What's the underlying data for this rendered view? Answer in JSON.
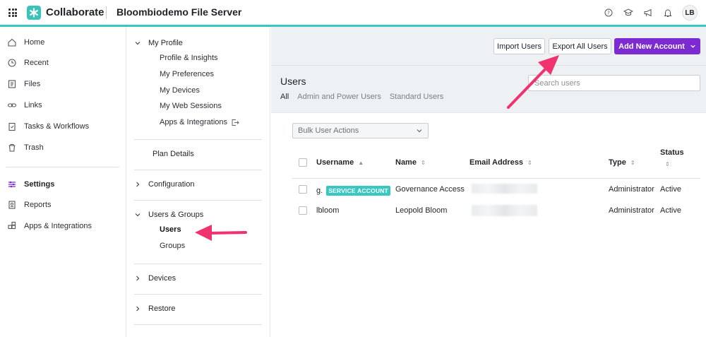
{
  "topbar": {
    "brand": "Collaborate",
    "server_name": "Bloombiodemo File Server",
    "icons": [
      "help-icon",
      "graduation-cap-icon",
      "megaphone-icon",
      "bell-icon"
    ],
    "avatar_initials": "LB"
  },
  "leftnav": {
    "items": [
      {
        "label": "Home",
        "icon": "home-icon"
      },
      {
        "label": "Recent",
        "icon": "clock-icon"
      },
      {
        "label": "Files",
        "icon": "files-icon"
      },
      {
        "label": "Links",
        "icon": "link-icon"
      },
      {
        "label": "Tasks & Workflows",
        "icon": "clipboard-icon"
      },
      {
        "label": "Trash",
        "icon": "trash-icon"
      }
    ],
    "bottom_items": [
      {
        "label": "Settings",
        "icon": "sliders-icon"
      },
      {
        "label": "Reports",
        "icon": "report-icon"
      },
      {
        "label": "Apps & Integrations",
        "icon": "apps-icon"
      }
    ]
  },
  "settings_nav": {
    "my_profile": {
      "label": "My Profile",
      "items": [
        "Profile & Insights",
        "My Preferences",
        "My Devices",
        "My Web Sessions",
        "Apps & Integrations"
      ]
    },
    "plan_details": "Plan Details",
    "configuration": "Configuration",
    "users_groups": {
      "label": "Users & Groups",
      "items": [
        "Users",
        "Groups"
      ]
    },
    "devices": "Devices",
    "restore": "Restore"
  },
  "main": {
    "buttons": {
      "import": "Import Users",
      "export": "Export All Users",
      "add": "Add New Account"
    },
    "title": "Users",
    "filter_tabs": [
      "All",
      "Admin and Power Users",
      "Standard Users"
    ],
    "search_placeholder": "Search users",
    "bulk_actions": "Bulk User Actions",
    "columns": {
      "username": "Username",
      "name": "Name",
      "email": "Email Address",
      "type": "Type",
      "status": "Status"
    },
    "rows": [
      {
        "username": "g.",
        "badge": "SERVICE ACCOUNT",
        "name": "Governance Access",
        "type": "Administrator",
        "status": "Active"
      },
      {
        "username": "lbloom",
        "badge": "",
        "name": "Leopold Bloom",
        "type": "Administrator",
        "status": "Active"
      }
    ]
  },
  "colors": {
    "accent_teal": "#38c8c4",
    "primary_purple": "#7c2bd2",
    "annotation_pink": "#f0336e"
  }
}
